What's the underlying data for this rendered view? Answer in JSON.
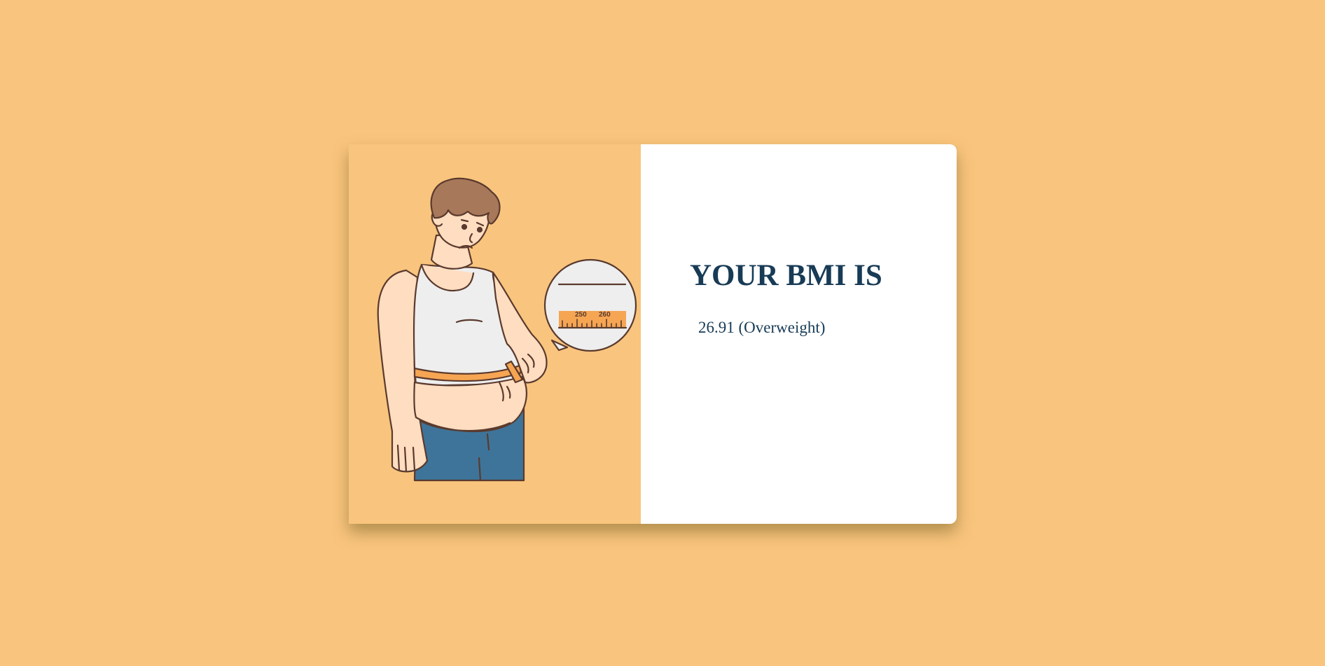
{
  "page": {
    "background_color": "#F9C47D",
    "accent_color": "#183B56"
  },
  "illustration": {
    "icon": "man-measuring-waist-illustration",
    "tape_labels": [
      "250",
      "260"
    ]
  },
  "result": {
    "title": "YOUR BMI IS",
    "value_text": "26.91 (Overweight)"
  }
}
